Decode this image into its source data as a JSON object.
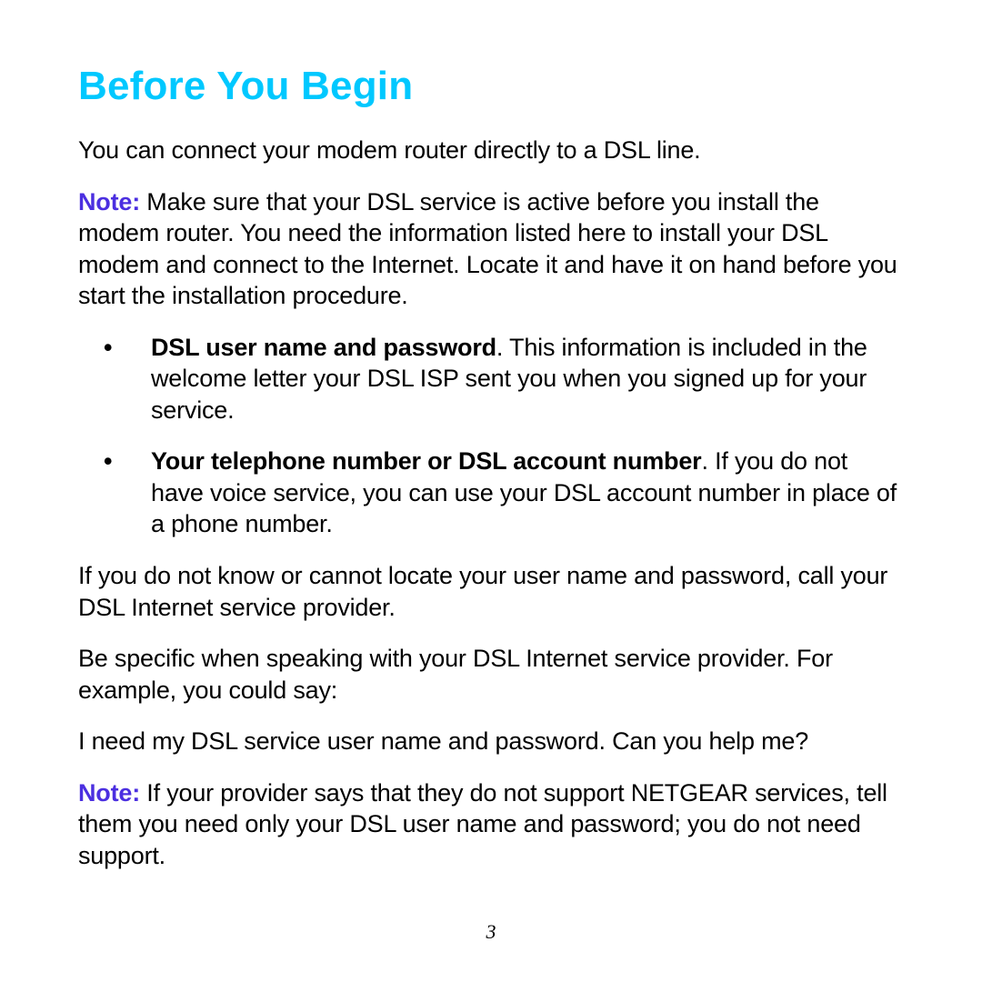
{
  "title": "Before You Begin",
  "intro": "You can connect your modem router directly to a DSL line.",
  "note1": {
    "label": "Note:",
    "text": "  Make sure that your DSL service is active before you install the modem router. You need the information listed here to install your DSL modem and connect to the Internet. Locate it and have it on hand before you start the installation procedure."
  },
  "bullets": [
    {
      "bold": "DSL user name and password",
      "rest": ". This information is included in the welcome letter your DSL ISP sent you when you signed up for your service."
    },
    {
      "bold": "Your telephone number or DSL account number",
      "rest": ". If you do not have voice service, you can use your DSL account number in place of a phone number."
    }
  ],
  "para_locate": "If you do not know or cannot locate your user name and password, call your DSL Internet service provider.",
  "para_specific": "Be specific when speaking with your DSL Internet service provider. For example, you could say:",
  "para_example": "I need my DSL service user name and password. Can you help me?",
  "note2": {
    "label": "Note:",
    "text": "  If your provider says that they do not support NETGEAR services, tell them you need only your DSL user name and password; you do not need support."
  },
  "page_number": "3"
}
